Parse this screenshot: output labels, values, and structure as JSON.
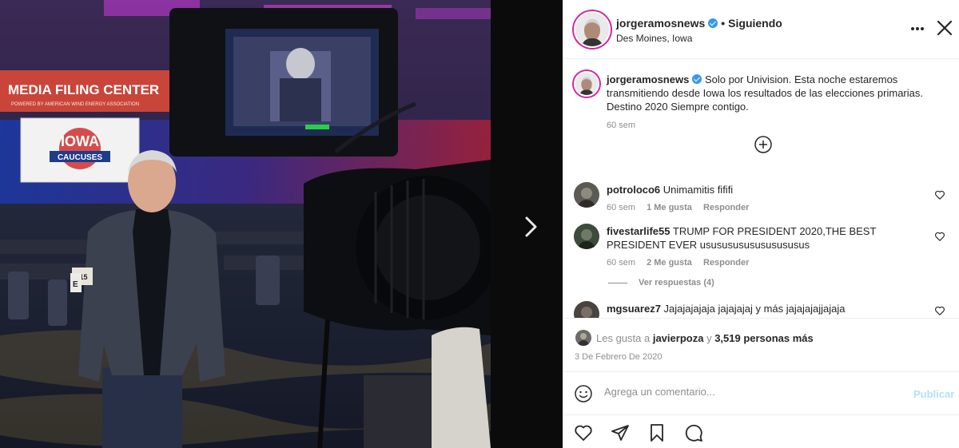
{
  "post": {
    "username": "jorgeramosnews",
    "separator": "•",
    "follow_status": "Siguiendo",
    "location": "Des Moines, Iowa",
    "caption_text": "Solo por Univision. Esta noche estaremos transmitiendo desde Iowa los resultados de las elecciones primarias. Destino 2020 Siempre contigo.",
    "caption_time": "60 sem"
  },
  "photo": {
    "banner_text": "MEDIA FILING CENTER",
    "banner_sub": "POWERED BY AMERICAN WIND ENERGY ASSOCIATION",
    "screen_text_1": "IOWA",
    "screen_text_2": "CAUCUSES",
    "table_label_1": "D15",
    "table_label_2": "E"
  },
  "comments": [
    {
      "username": "potroloco6",
      "text": "Unimamitis fififi",
      "time": "60 sem",
      "likes": "1 Me gusta",
      "reply": "Responder"
    },
    {
      "username": "fivestarlife55",
      "text": "TRUMP FOR PRESIDENT 2020,THE BEST PRESIDENT EVER usususususususususus",
      "time": "60 sem",
      "likes": "2 Me gusta",
      "reply": "Responder"
    },
    {
      "username": "mgsuarez7",
      "text": "Jajajajajaja jajajajaj y más jajajajajjajaja"
    }
  ],
  "view_replies": "Ver respuestas (4)",
  "likes": {
    "prefix": "Les gusta a",
    "user": "javierpoza",
    "conj": "y",
    "others": "3,519 personas más"
  },
  "date": "3 De Febrero De 2020",
  "add_comment": {
    "placeholder": "Agrega un comentario...",
    "publish": "Publicar"
  },
  "colors": {
    "verified": "#3897f0",
    "publish_disabled": "#b2dffc",
    "text": "#262626",
    "muted": "#8e8e8e"
  }
}
